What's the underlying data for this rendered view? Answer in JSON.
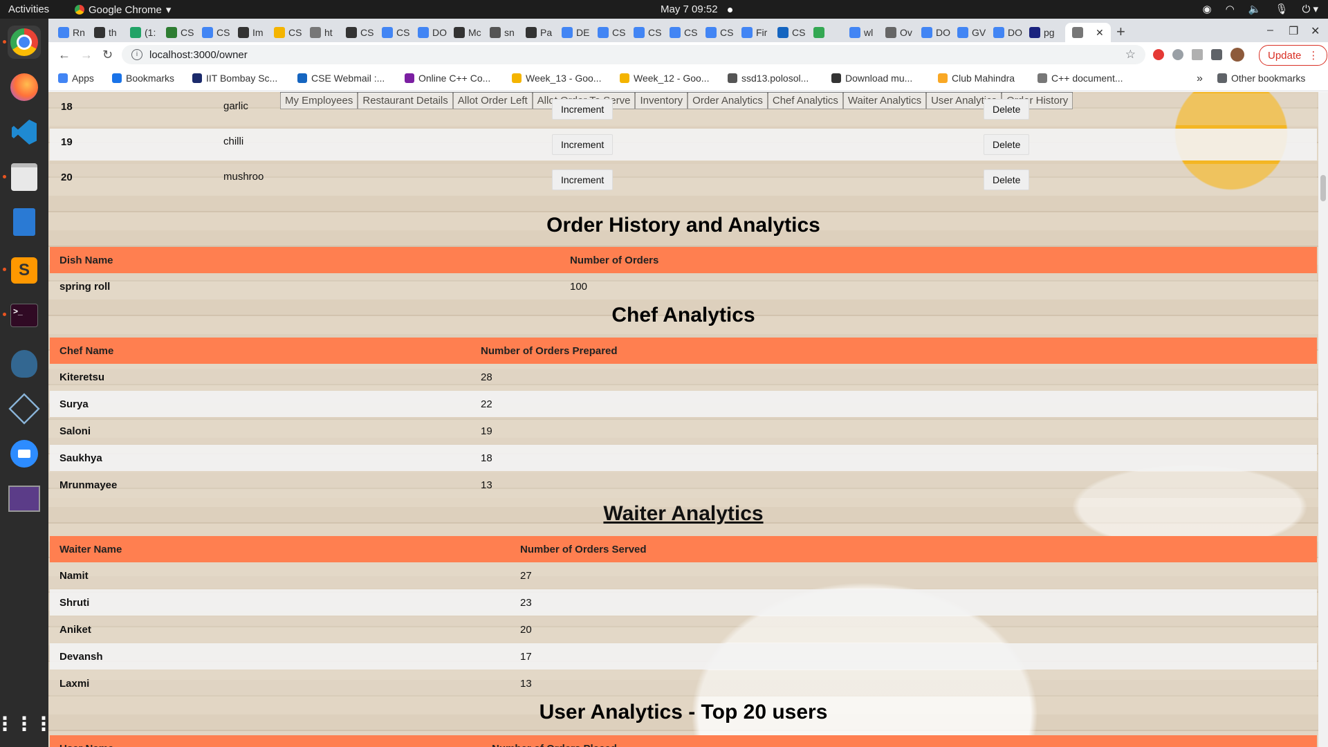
{
  "os": {
    "activities": "Activities",
    "app_name": "Google Chrome",
    "clock": "May 7  09:52"
  },
  "browser": {
    "tabs": [
      "Rn",
      "th",
      "(1:",
      "CS",
      "CS",
      "Im",
      "CS",
      "ht",
      "CS",
      "CS",
      "DO",
      "Mc",
      "sn",
      "Pa",
      "DE",
      "CS",
      "CS",
      "CS",
      "CS",
      "Fir",
      "CS",
      "",
      "wl",
      "Ov",
      "DO",
      "GV",
      "DO",
      "pg",
      ""
    ],
    "url": "localhost:3000/owner",
    "update_label": "Update",
    "bookmarks": [
      "Apps",
      "Bookmarks",
      "IIT Bombay Sc...",
      "CSE Webmail :...",
      "Online C++ Co...",
      "Week_13 - Goo...",
      "Week_12 - Goo...",
      "ssd13.polosol...",
      "Download mu...",
      "Club Mahindra",
      "C++ document..."
    ],
    "bookmarks_more": "»",
    "other_bookmarks": "Other bookmarks"
  },
  "nav": [
    "My Employees",
    "Restaurant Details",
    "Allot Order Left",
    "Allot Order To Serve",
    "Inventory",
    "Order Analytics",
    "Chef Analytics",
    "Waiter Analytics",
    "User Analytics",
    "Order History"
  ],
  "inventory_rows": [
    {
      "id": "18",
      "name": "garlic",
      "increment": "Increment",
      "delete": "Delete"
    },
    {
      "id": "19",
      "name": "chilli",
      "increment": "Increment",
      "delete": "Delete"
    },
    {
      "id": "20",
      "name": "mushroo",
      "increment": "Increment",
      "delete": "Delete"
    }
  ],
  "order_history": {
    "title": "Order History and Analytics",
    "headers": [
      "Dish Name",
      "Number of Orders"
    ],
    "rows": [
      [
        "spring roll",
        "100"
      ]
    ]
  },
  "chef": {
    "title": "Chef Analytics",
    "headers": [
      "Chef Name",
      "Number of Orders Prepared"
    ],
    "rows": [
      [
        "Kiteretsu",
        "28"
      ],
      [
        "Surya",
        "22"
      ],
      [
        "Saloni",
        "19"
      ],
      [
        "Saukhya",
        "18"
      ],
      [
        "Mrunmayee",
        "13"
      ]
    ]
  },
  "waiter": {
    "title": "Waiter Analytics",
    "headers": [
      "Waiter Name",
      "Number of Orders Served"
    ],
    "rows": [
      [
        "Namit",
        "27"
      ],
      [
        "Shruti",
        "23"
      ],
      [
        "Aniket",
        "20"
      ],
      [
        "Devansh",
        "17"
      ],
      [
        "Laxmi",
        "13"
      ]
    ]
  },
  "user": {
    "title": "User Analytics - Top 20 users",
    "headers": [
      "User Name",
      "Number of Orders Placed"
    ]
  },
  "colors": {
    "table_header": "#ff7f50",
    "topbar": "#1d1d1d",
    "dock": "#2c2c2c"
  }
}
